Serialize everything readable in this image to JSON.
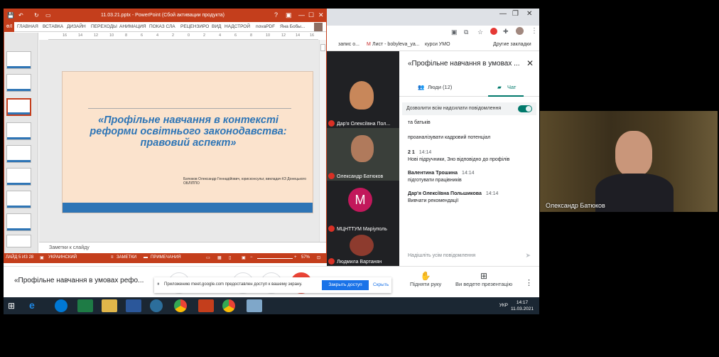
{
  "powerpoint": {
    "title": "11.03.21.pptx - PowerPoint (Сбой активации продукта)",
    "file_tab": "ФЛ",
    "ribbon_tabs": [
      "ГЛАВНАЯ",
      "ВСТАВКА",
      "ДИЗАЙН",
      "ПЕРЕХОДЫ",
      "АНИМАЦИЯ",
      "ПОКАЗ СЛА",
      "РЕЦЕНЗИРО",
      "ВИД",
      "НАДСТРОЙ",
      "novaPDF",
      "Яна Бобы..."
    ],
    "ruler_numbers": [
      "16",
      "14",
      "12",
      "10",
      "8",
      "6",
      "4",
      "2",
      "0",
      "2",
      "4",
      "6",
      "8",
      "10",
      "12",
      "14",
      "16"
    ],
    "slide_title": "«Профільне навчання в контексті реформи освітнього законодавства: правовий аспект»",
    "slide_author": "Батюков Олександр Геннадійович, юрисконсульт, викладач КЗ Донецького ОБЛІППО",
    "notes_placeholder": "Заметки к слайду",
    "status_slide": "ЛАЙД 5 ИЗ 28",
    "status_language": "УКРАИНСКИЙ",
    "status_notes": "ЗАМЕТКИ",
    "status_comments": "ПРИМЕЧАНИЯ",
    "zoom": "57%"
  },
  "browser": {
    "bookmarks": [
      "запис о...",
      "Лист - bobyleva_ya...",
      "курси УМО",
      "Другие закладки"
    ]
  },
  "participants": [
    {
      "name": "Дар'я Олексіївна Пол...",
      "type": "video"
    },
    {
      "name": "Олександр Батюков",
      "type": "video"
    },
    {
      "name": "МЦНТТУМ Маріуполь",
      "type": "avatar",
      "initial": "M"
    },
    {
      "name": "Людмила Вартанян",
      "type": "video"
    }
  ],
  "chat": {
    "title": "«Профільне навчання в умовах ...",
    "tab_people": "Люди (12)",
    "tab_chat": "Чат",
    "allow_messages": "Дозволити всім надсилати повідомлення",
    "messages": [
      {
        "author": "",
        "time": "",
        "text": "та батьків"
      },
      {
        "author": "",
        "time": "",
        "text": "проаналізувати кадровий потенціал"
      },
      {
        "author": "2 1",
        "time": "14:14",
        "text": "Нові підручники, Зно відповідно до профілів"
      },
      {
        "author": "Валентина Трошина",
        "time": "14:14",
        "text": "підготувати працівників"
      },
      {
        "author": "Дар'я Олексіївна Польшикова",
        "time": "14:14",
        "text": "Вивчати рекомендації"
      }
    ],
    "input_placeholder": "Надішліть усім повідомлення"
  },
  "meet_bottom": {
    "meeting_title": "«Профільне навчання в умовах рефо...",
    "notification_text": "Приложению meet.google.com предоставлен доступ к вашему экрану.",
    "notification_button": "Закрыть доступ",
    "notification_hide": "Скрыть",
    "raise_hand": "Підняти руку",
    "presenting": "Ви ведете презентацію"
  },
  "taskbar": {
    "language": "УКР",
    "time": "14:17",
    "date": "11.03.2021"
  },
  "right_video": {
    "name": "Олександр Батюков"
  },
  "colors": {
    "ppt_accent": "#c43e1c",
    "slide_title": "#2e75b6",
    "slide_bg": "#fbe3cd",
    "meet_teal": "#00796b",
    "meet_blue": "#1a73e8"
  }
}
